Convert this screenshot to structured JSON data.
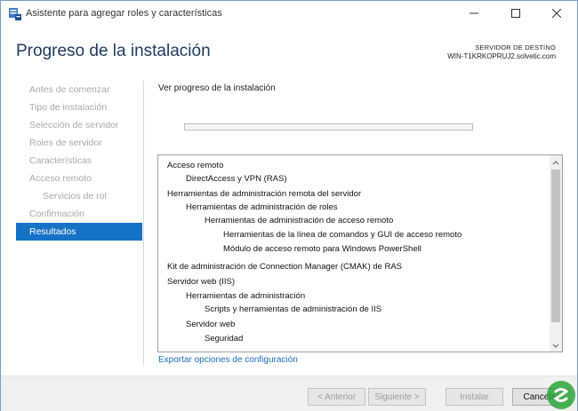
{
  "window": {
    "title": "Asistente para agregar roles y características",
    "icons": {
      "app": "server-manager-icon",
      "minimize": "minimize-icon",
      "maximize": "maximize-icon",
      "close": "close-icon"
    }
  },
  "header": {
    "title": "Progreso de la instalación",
    "dest_label": "SERVIDOR DE DESTINO",
    "dest_server": "WIN-T1KRKOPRUJ2.solvetic.com"
  },
  "nav": {
    "items": [
      {
        "label": "Antes de comenzar"
      },
      {
        "label": "Tipo de instalación"
      },
      {
        "label": "Selección de servidor"
      },
      {
        "label": "Roles de servidor"
      },
      {
        "label": "Características"
      },
      {
        "label": "Acceso remoto"
      },
      {
        "label": "Servicios de rol"
      },
      {
        "label": "Confirmación"
      },
      {
        "label": "Resultados"
      }
    ],
    "active_index": 8
  },
  "main": {
    "heading": "Ver progreso de la instalación",
    "progress_percent": 0,
    "results": [
      {
        "text": "Acceso remoto",
        "level": 0
      },
      {
        "text": "DirectAccess y VPN (RAS)",
        "level": 1
      },
      {
        "text": "Herramientas de administración remota del servidor",
        "level": 0
      },
      {
        "text": "Herramientas de administración de roles",
        "level": 1
      },
      {
        "text": "Herramientas de administración de acceso remoto",
        "level": 2
      },
      {
        "text": "Herramientas de la línea de comandos y GUI de acceso remoto",
        "level": 3
      },
      {
        "text": "Módulo de acceso remoto para Windows PowerShell",
        "level": 3
      },
      {
        "text": "Kit de administración de Connection Manager (CMAK) de RAS",
        "level": 0
      },
      {
        "text": "Servidor web (IIS)",
        "level": 0
      },
      {
        "text": "Herramientas de administración",
        "level": 1
      },
      {
        "text": "Scripts y herramientas de administración de IIS",
        "level": 2
      },
      {
        "text": "Servidor web",
        "level": 1
      },
      {
        "text": "Seguridad",
        "level": 2
      }
    ],
    "export_link": "Exportar opciones de configuración"
  },
  "footer": {
    "prev": "< Anterior",
    "next": "Siguiente >",
    "install": "Instalar",
    "cancel": "Cancelar"
  },
  "colors": {
    "accent": "#1672c7",
    "title": "#1e3a5f",
    "link": "#1a6fc0"
  }
}
